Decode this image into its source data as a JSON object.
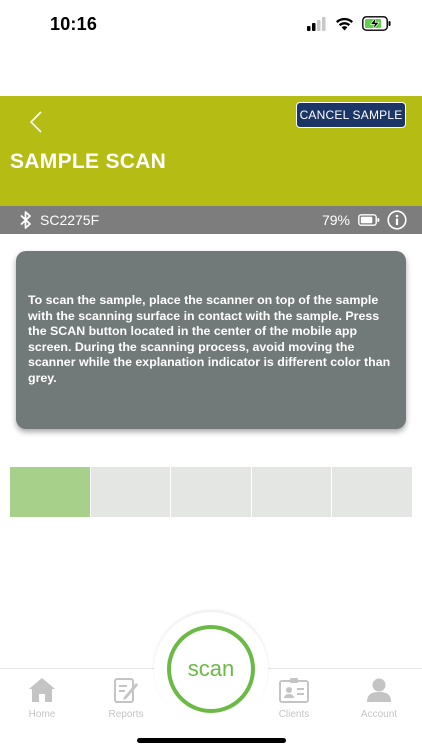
{
  "status_bar": {
    "time": "10:16"
  },
  "header": {
    "title": "SAMPLE SCAN",
    "cancel_label": "CANCEL SAMPLE",
    "color": "#b5bd14"
  },
  "device": {
    "id": "SC2275F",
    "battery": "79%"
  },
  "instructions": {
    "text": "To scan the sample, place the scanner on top of the sample with the scanning surface in contact with the sample. Press the SCAN button located in the center of the mobile app screen. During the scanning process, avoid moving the scanner while the explanation indicator is different color than grey."
  },
  "progress": {
    "segments_total": 5,
    "segments_done": 1
  },
  "scan": {
    "label": "scan",
    "color": "#6aba45"
  },
  "tabs": [
    {
      "label": "Home",
      "icon": "home-icon"
    },
    {
      "label": "Reports",
      "icon": "reports-icon"
    },
    {
      "label": "Clients",
      "icon": "clients-icon"
    },
    {
      "label": "Account",
      "icon": "account-icon"
    }
  ]
}
